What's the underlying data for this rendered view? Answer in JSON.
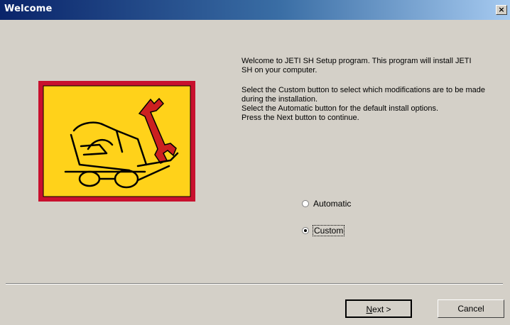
{
  "window": {
    "title": "Welcome",
    "close_glyph": "×"
  },
  "logo": {
    "icon": "forklift-wrench-icon",
    "colors": {
      "frame": "#c8102e",
      "background": "#ffd21a",
      "wrench": "#cc2020",
      "line": "#000000"
    }
  },
  "content": {
    "intro": "Welcome to JETI SH Setup program. This program will install JETI SH on your computer.",
    "instructions_1": "Select the Custom button to select which modifications are to be made during the installation.",
    "instructions_2": "Select the Automatic button for the default install options.",
    "instructions_3": "Press the Next button to continue."
  },
  "options": {
    "automatic_label": "Automatic",
    "custom_label": "Custom",
    "selected": "Custom"
  },
  "buttons": {
    "next_mnemonic": "N",
    "next_rest": "ext >",
    "cancel_label": "Cancel"
  }
}
